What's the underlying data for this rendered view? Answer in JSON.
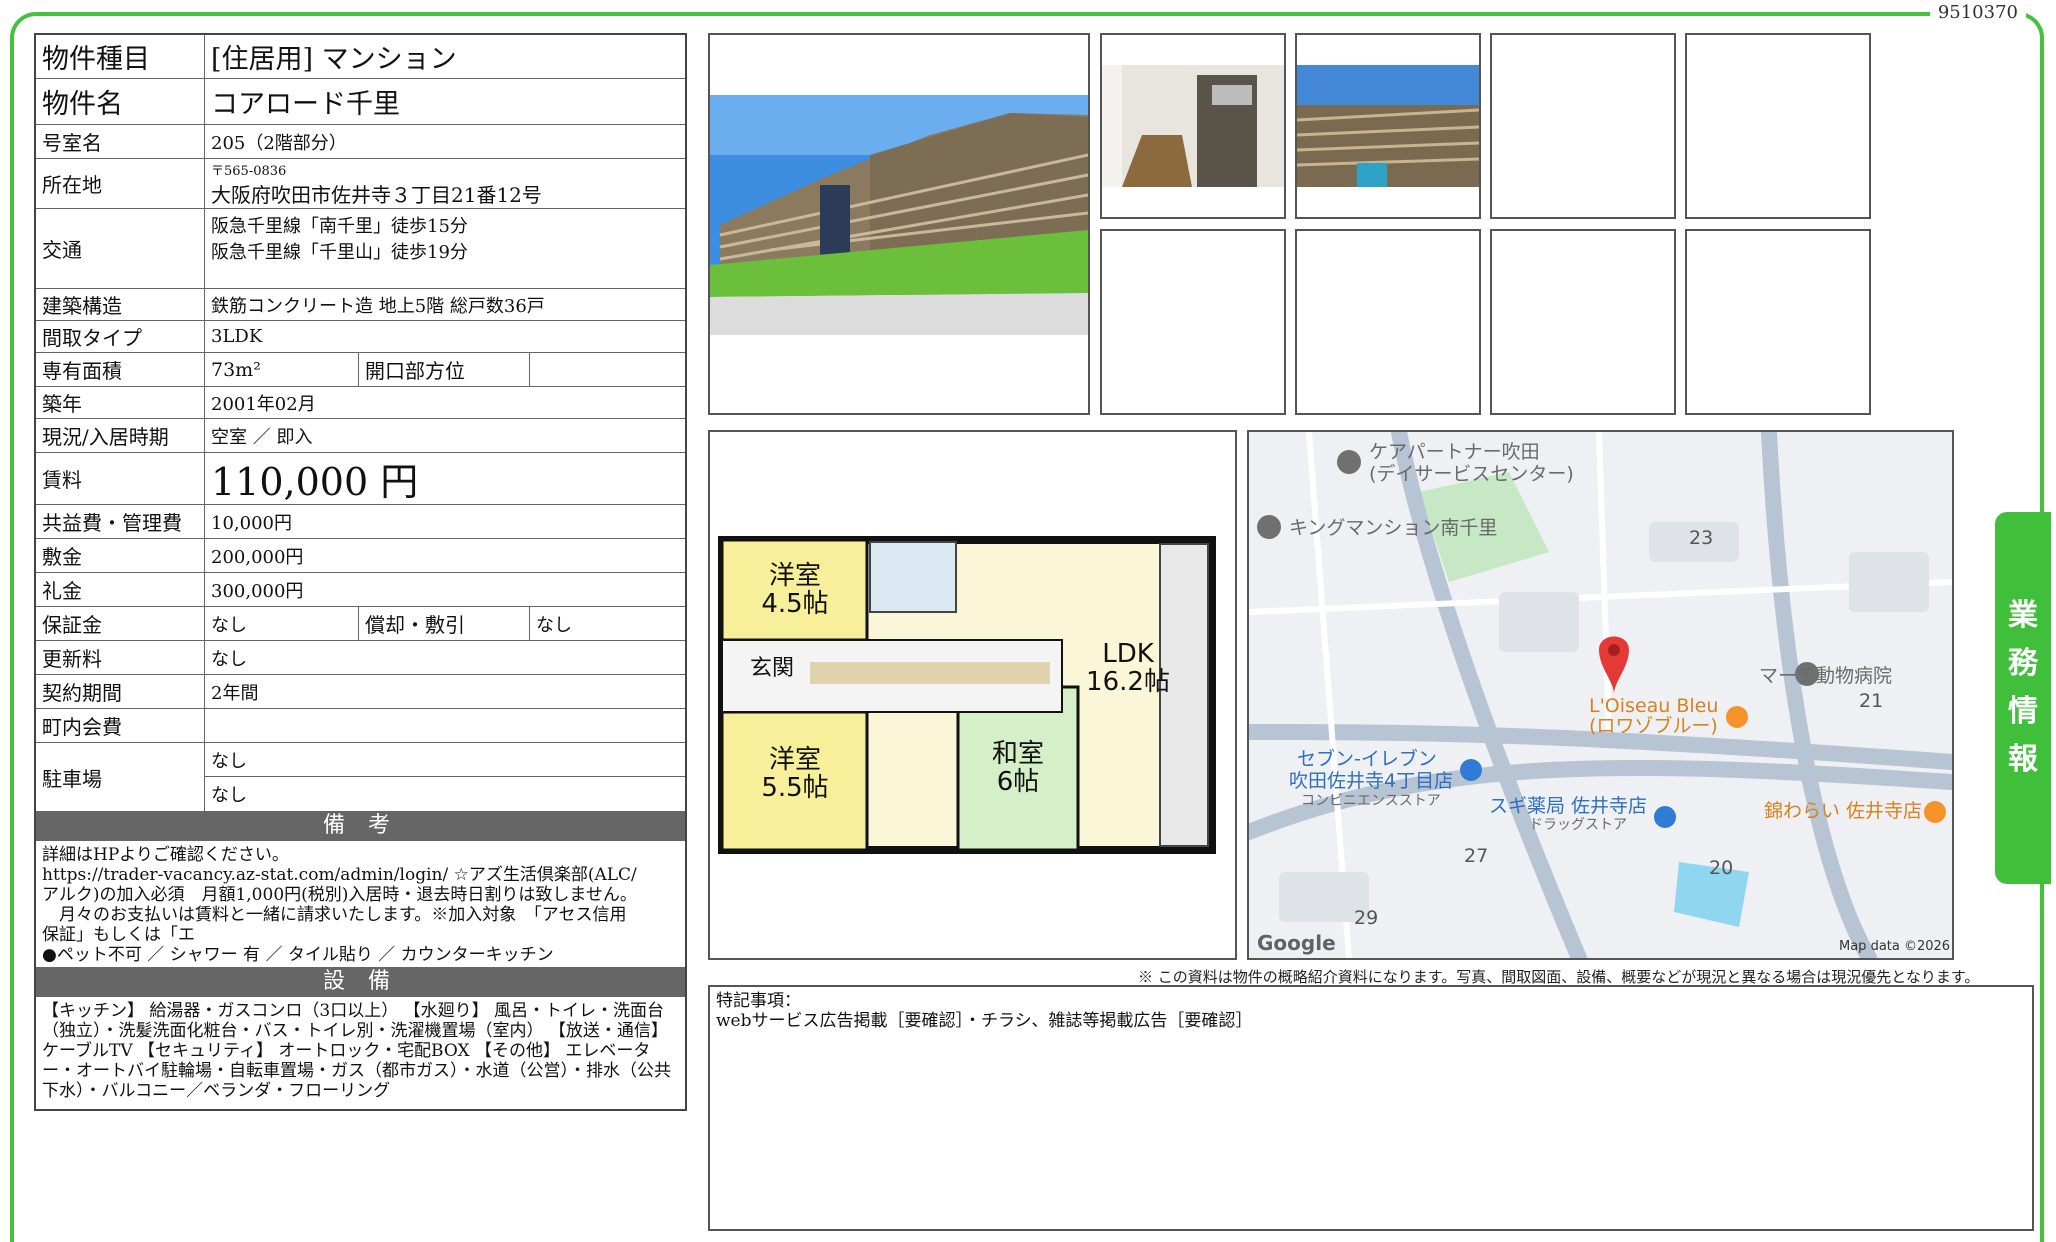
{
  "doc_id": "9510370",
  "side_tab": [
    "業",
    "務",
    "情",
    "報"
  ],
  "property": {
    "type_label": "物件種目",
    "type_value": "[住居用]  マンション",
    "name_label": "物件名",
    "name_value": "コアロード千里",
    "room_label": "号室名",
    "room_value": "205（2階部分）",
    "address_label": "所在地",
    "postal": "〒565-0836",
    "address": "大阪府吹田市佐井寺３丁目21番12号",
    "access_label": "交通",
    "access_1": "阪急千里線「南千里」徒歩15分",
    "access_2": "阪急千里線「千里山」徒歩19分",
    "structure_label": "建築構造",
    "structure_value": "鉄筋コンクリート造 地上5階 総戸数36戸",
    "layout_label": "間取タイプ",
    "layout_value": "3LDK",
    "area_label": "専有面積",
    "area_value": "73m²",
    "direction_label": "開口部方位",
    "direction_value": "",
    "built_label": "築年",
    "built_value": "2001年02月",
    "status_label": "現況/入居時期",
    "status_value": "空室 ／ 即入",
    "rent_label": "賃料",
    "rent_value": "110,000 円",
    "fee_label": "共益費・管理費",
    "fee_value": "10,000円",
    "deposit_label": "敷金",
    "deposit_value": "200,000円",
    "keymoney_label": "礼金",
    "keymoney_value": "300,000円",
    "guarantee_label": "保証金",
    "guarantee_value": "なし",
    "amortize_label": "償却・敷引",
    "amortize_value": "なし",
    "renewal_label": "更新料",
    "renewal_value": "なし",
    "contract_label": "契約期間",
    "contract_value": "2年間",
    "town_label": "町内会費",
    "town_value": "",
    "parking_label": "駐車場",
    "parking_1": "なし",
    "parking_2": "なし"
  },
  "remarks": {
    "title": "備 考",
    "line1": "詳細はHPよりご確認ください。",
    "line2": "https://trader-vacancy.az-stat.com/admin/login/ ☆アズ生活倶楽部(ALC/",
    "line3": "アルク)の加入必須　月額1,000円(税別)入居時・退去時日割りは致しません。",
    "line4": "　月々のお支払いは賃料と一緒に請求いたします。※加入対象　「アセス信用",
    "line5": "保証」もしくは「エ",
    "line6": "●ペット不可 ／ シャワー 有 ／ タイル貼り ／ カウンターキッチン"
  },
  "equipment": {
    "title": "設 備",
    "text": "【キッチン】 給湯器・ガスコンロ（3口以上） 【水廻り】 風呂・トイレ・洗面台（独立）・洗髪洗面化粧台・バス・トイレ別・洗濯機置場（室内） 【放送・通信】 ケーブルTV 【セキュリティ】 オートロック・宅配BOX 【その他】 エレベーター・オートバイ駐輪場・自転車置場・ガス（都市ガス）・水道（公営）・排水（公共下水）・バルコニー／ベランダ・フローリング"
  },
  "floorplan": {
    "room1": "洋室",
    "room1_size": "4.5帖",
    "entry": "玄関",
    "room2": "洋室",
    "room2_size": "5.5帖",
    "room3": "和室",
    "room3_size": "6帖",
    "ldk": "LDK",
    "ldk_size": "16.2帖"
  },
  "map": {
    "poi1_a": "ケアパートナー吹田",
    "poi1_b": "(デイサービスセンター)",
    "poi2": "キングマンション南千里",
    "block23": "23",
    "block21": "21",
    "block27": "27",
    "block20": "20",
    "block29": "29",
    "poi3": "マーチ動物病院",
    "poi4_a": "L'Oiseau Bleu",
    "poi4_b": "(ロワゾブルー)",
    "poi5_a": "セブン-イレブン",
    "poi5_b": "吹田佐井寺4丁目店",
    "poi5_c": "コンビニエンスストア",
    "poi6_a": "スギ薬局 佐井寺店",
    "poi6_b": "ドラッグストア",
    "poi7": "錦わらい 佐井寺店",
    "google": "Google",
    "mapdata": "Map data ©2026"
  },
  "notice": "※ この資料は物件の概略紹介資料になります。写真、間取図面、設備、概要などが現況と異なる場合は現況優先となります。",
  "tokki": {
    "title": "特記事項：",
    "text": "webサービス広告掲載［要確認］・チラシ、雑誌等掲載広告［要確認］"
  },
  "colors": {
    "frame": "#44c23a",
    "tab": "#3fbf3a",
    "section_header": "#666666"
  }
}
